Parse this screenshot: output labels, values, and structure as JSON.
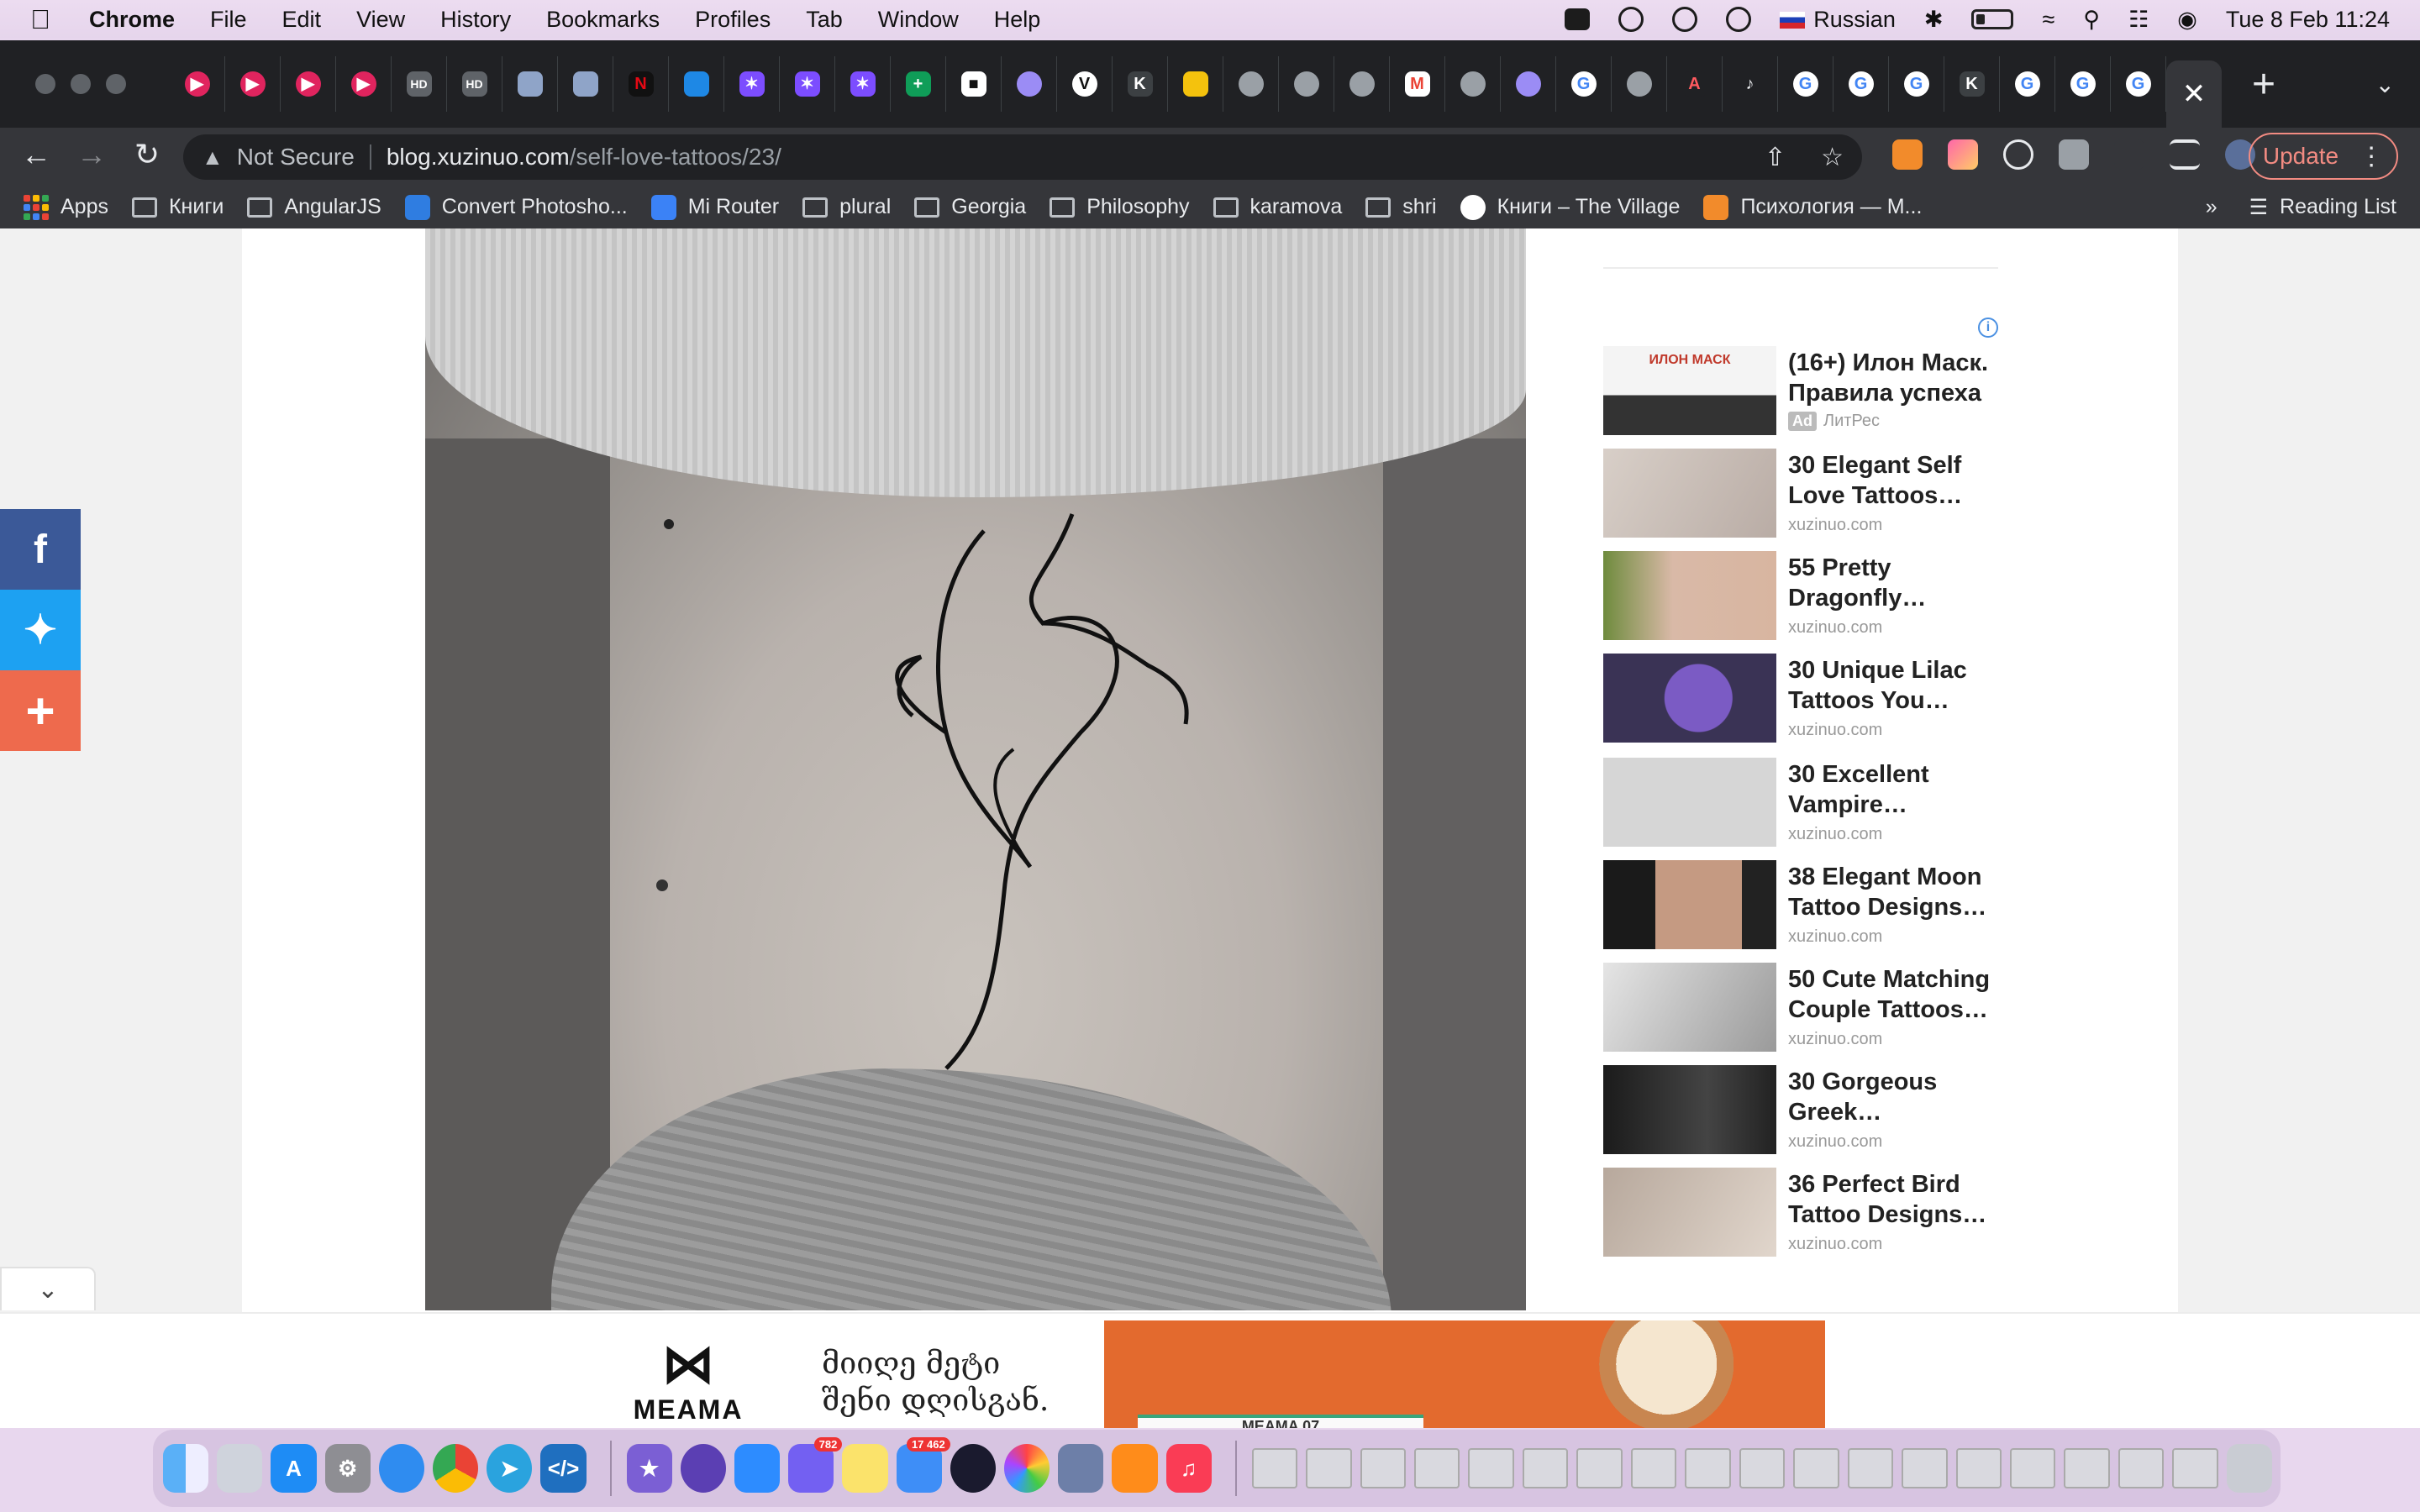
{
  "menubar": {
    "items": [
      "Chrome",
      "File",
      "Edit",
      "View",
      "History",
      "Bookmarks",
      "Profiles",
      "Tab",
      "Window",
      "Help"
    ],
    "input_source": "Russian",
    "datetime": "Tue 8 Feb  11:24"
  },
  "toolbar": {
    "security_label": "Not Secure",
    "url_host": "blog.xuzinuo.com",
    "url_path": "/self-love-tattoos/23/",
    "update_label": "Update"
  },
  "bookmarks": {
    "items": [
      "Apps",
      "Книги",
      "AngularJS",
      "Convert Photosho...",
      "Mi Router",
      "plural",
      "Georgia",
      "Philosophy",
      "karamova",
      "shri",
      "Книги – The Village",
      "Психология — M..."
    ],
    "overflow": "»",
    "reading_list": "Reading List"
  },
  "sidebar": {
    "ad_info": "i",
    "sponsored": {
      "title_line1": "(16+) Илон Маск.",
      "title_line2": "Правила успеха",
      "ad_badge": "Ad",
      "source": "ЛитРес",
      "thumb_text": "ИЛОН МАСК"
    },
    "recommendations": [
      {
        "line1": "30 Elegant Self",
        "line2": "Love Tattoos…",
        "source": "xuzinuo.com"
      },
      {
        "line1": "55 Pretty",
        "line2": "Dragonfly…",
        "source": "xuzinuo.com"
      },
      {
        "line1": "30 Unique Lilac",
        "line2": "Tattoos You…",
        "source": "xuzinuo.com"
      },
      {
        "line1": "30 Excellent",
        "line2": "Vampire…",
        "source": "xuzinuo.com"
      },
      {
        "line1": "38 Elegant Moon",
        "line2": "Tattoo Designs…",
        "source": "xuzinuo.com"
      },
      {
        "line1": "50 Cute Matching",
        "line2": "Couple Tattoos…",
        "source": "xuzinuo.com"
      },
      {
        "line1": "30 Gorgeous",
        "line2": "Greek…",
        "source": "xuzinuo.com"
      },
      {
        "line1": "36 Perfect Bird",
        "line2": "Tattoo Designs…",
        "source": "xuzinuo.com"
      }
    ]
  },
  "bottom_ad": {
    "brand": "MEAMA",
    "slogan_line1": "მიიღე მეტი",
    "slogan_line2": "შენი დღისგან.",
    "box_label": "MEAMA",
    "box_number": "07"
  },
  "dock": {
    "viber_badge": "782",
    "mail_badge": "17 462"
  },
  "colors": {
    "facebook": "#3b5998",
    "twitter": "#1da1f2",
    "share": "#ee6a4d",
    "update_accent": "#f28b82"
  }
}
